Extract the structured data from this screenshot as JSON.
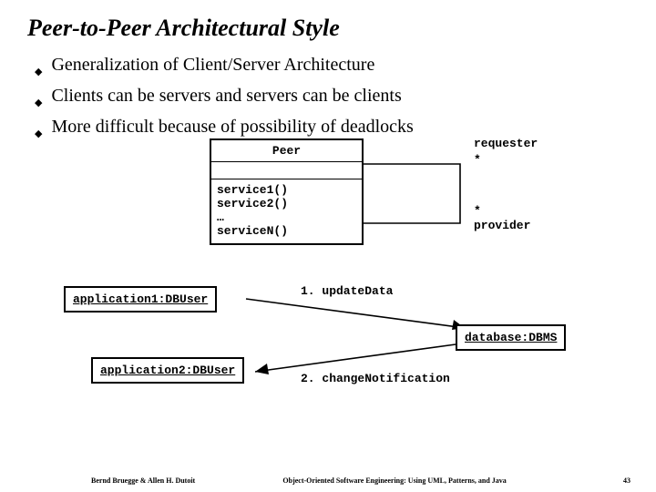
{
  "title": "Peer-to-Peer Architectural Style",
  "bullets": [
    "Generalization of Client/Server Architecture",
    "Clients can be servers and servers can be clients",
    "More difficult because of possibility of deadlocks"
  ],
  "uml": {
    "class_name": "Peer",
    "ops": [
      "service1()",
      "service2()",
      "…",
      "serviceN()"
    ],
    "assoc": {
      "requester": {
        "role": "requester",
        "mult": "*"
      },
      "provider": {
        "role": "provider",
        "mult": "*"
      }
    }
  },
  "sequence": {
    "objects": {
      "app1": "application1:DBUser",
      "app2": "application2:DBUser",
      "db": "database:DBMS"
    },
    "messages": {
      "m1": "1. updateData",
      "m2": "2. changeNotification"
    }
  },
  "footer": {
    "left": "Bernd Bruegge & Allen H. Dutoit",
    "center": "Object-Oriented Software Engineering: Using UML, Patterns, and Java",
    "page": "43"
  }
}
